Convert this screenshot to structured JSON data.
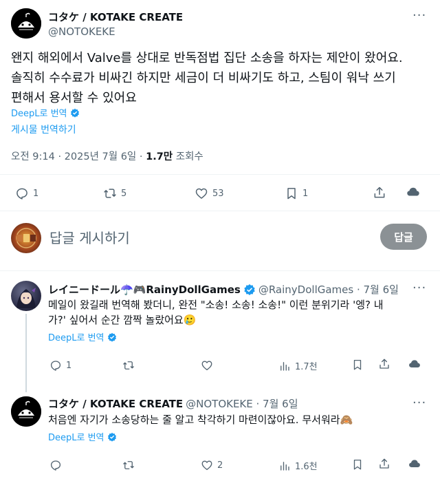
{
  "main_tweet": {
    "display_name": "コタケ / KOTAKE CREATE",
    "handle": "@NOTOKEKE",
    "text_lines": [
      "왠지 해외에서 Valve를 상대로 반독점법 집단 소송을 하자는 제안이 왔어요.",
      "솔직히 수수료가 비싸긴 하지만 세금이 더 비싸기도 하고, 스팀이 워낙 쓰기",
      "편해서 용서할 수 있어요"
    ],
    "deepl_label": "DeepL로 번역",
    "translate_post": "게시물 번역하기",
    "time": "오전 9:14 · 2025년 7월 6일 · ",
    "views_count": "1.7만",
    "views_label": " 조회수",
    "stats": {
      "replies": "1",
      "retweets": "5",
      "likes": "53",
      "bookmarks": "1"
    }
  },
  "reply_box": {
    "placeholder": "답글 게시하기",
    "button": "답글"
  },
  "replies": [
    {
      "display_name": "レイニードール☂️🎮RainyDollGames",
      "handle_time": "@RainyDollGames · 7월 6일",
      "text_lines": [
        "메일이 왔길래 번역해 봤더니, 완전 \"소송! 소송! 소송!\" 이런 분위기라 '엥? 내",
        "가?' 싶어서 순간 깜짝 놀랐어요🥲"
      ],
      "deepl_label": "DeepL로 번역",
      "stats": {
        "replies": "1",
        "retweets": "",
        "likes": "",
        "views": "1.7천"
      }
    },
    {
      "display_name": "コタケ / KOTAKE CREATE",
      "handle_time": "@NOTOKEKE · 7월 6일",
      "text_lines": [
        "처음엔 자기가 소송당하는 줄 알고 착각하기 마련이잖아요. 무서워라🙈"
      ],
      "deepl_label": "DeepL로 번역",
      "stats": {
        "replies": "",
        "retweets": "",
        "likes": "2",
        "views": "1.6천"
      }
    }
  ],
  "colors": {
    "link": "#1d9bf0",
    "muted": "#536471",
    "text": "#0f1419",
    "reply_button": "#8b9195"
  }
}
